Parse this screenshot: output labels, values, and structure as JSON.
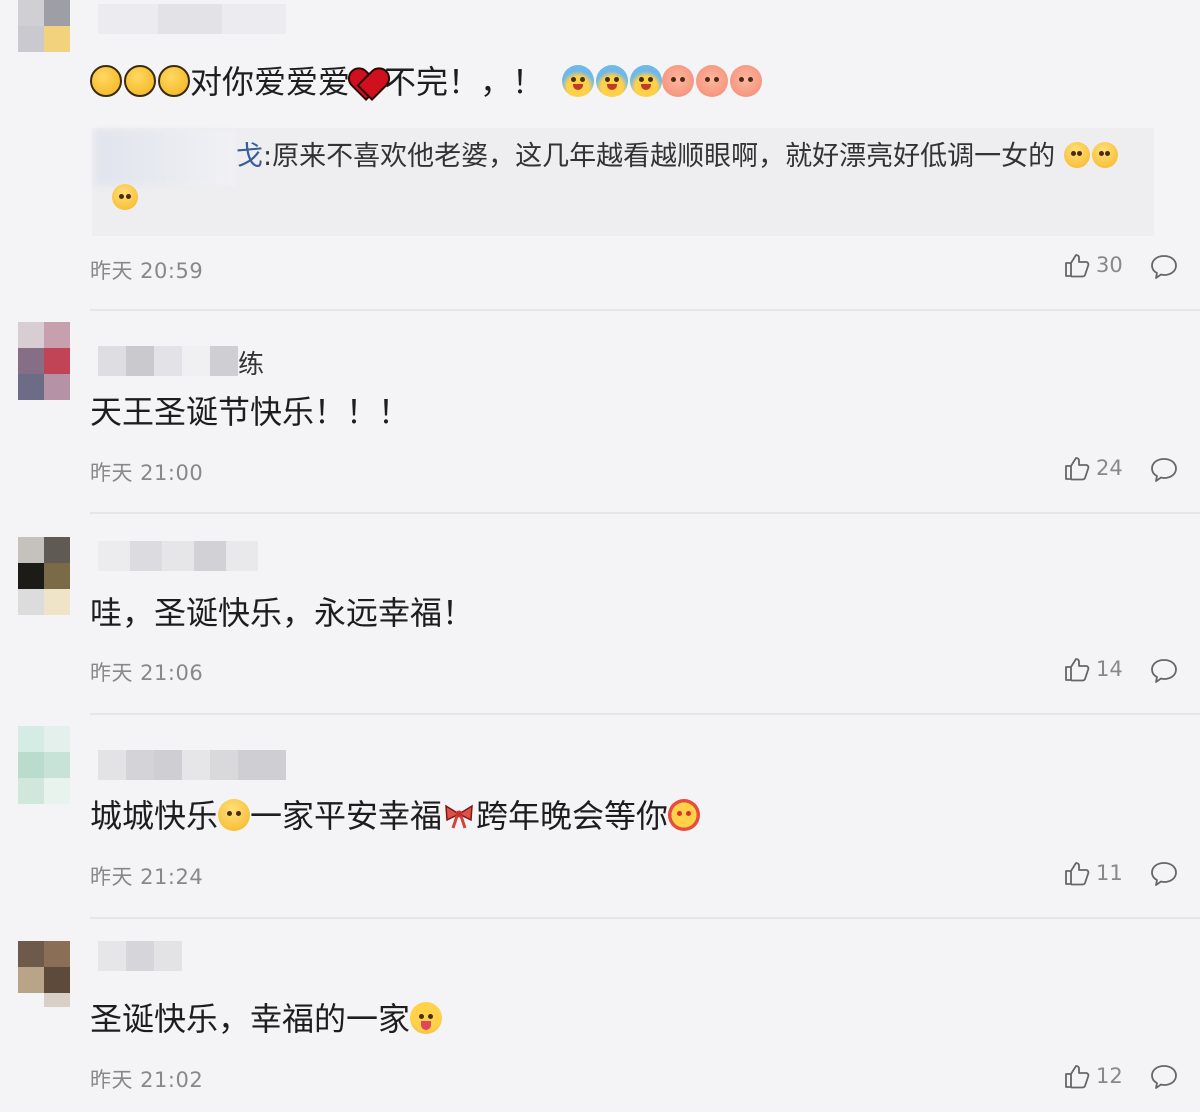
{
  "comments": [
    {
      "name_visible": "",
      "text_before": "对你爱爱爱",
      "text_after": "不完！，！",
      "quote": {
        "name_tail": "戈",
        "text": ":原来不喜欢他老婆，这几年越看越顺眼啊，就好漂亮好低调一女的"
      },
      "time": "昨天 20:59",
      "likes": "30"
    },
    {
      "name_visible": "练",
      "text": "天王圣诞节快乐！！！",
      "time": "昨天 21:00",
      "likes": "24"
    },
    {
      "name_visible": "",
      "text": "哇，圣诞快乐，永远幸福！",
      "time": "昨天 21:06",
      "likes": "14"
    },
    {
      "name_visible": "",
      "text_a": "城城快乐",
      "text_b": "一家平安幸福",
      "text_c": "跨年晚会等你",
      "time": "昨天 21:24",
      "likes": "11"
    },
    {
      "name_visible": "",
      "text": "圣诞快乐，幸福的一家",
      "time": "昨天 21:02",
      "likes": "12"
    }
  ],
  "icons": {
    "like": "thumbs-up-icon",
    "reply": "speech-bubble-icon",
    "clap": "clapping-hands-emoji",
    "heart": "red-heart-emoji",
    "scream": "scream-emoji",
    "pig": "pig-face-emoji",
    "gasp": "gasp-emoji",
    "bow": "red-bow-emoji"
  },
  "colors": {
    "background": "#f4f4f6",
    "text": "#1d1d1f",
    "meta": "#888888",
    "quote_bg": "#eeeef1",
    "link": "#3a5d9a"
  }
}
